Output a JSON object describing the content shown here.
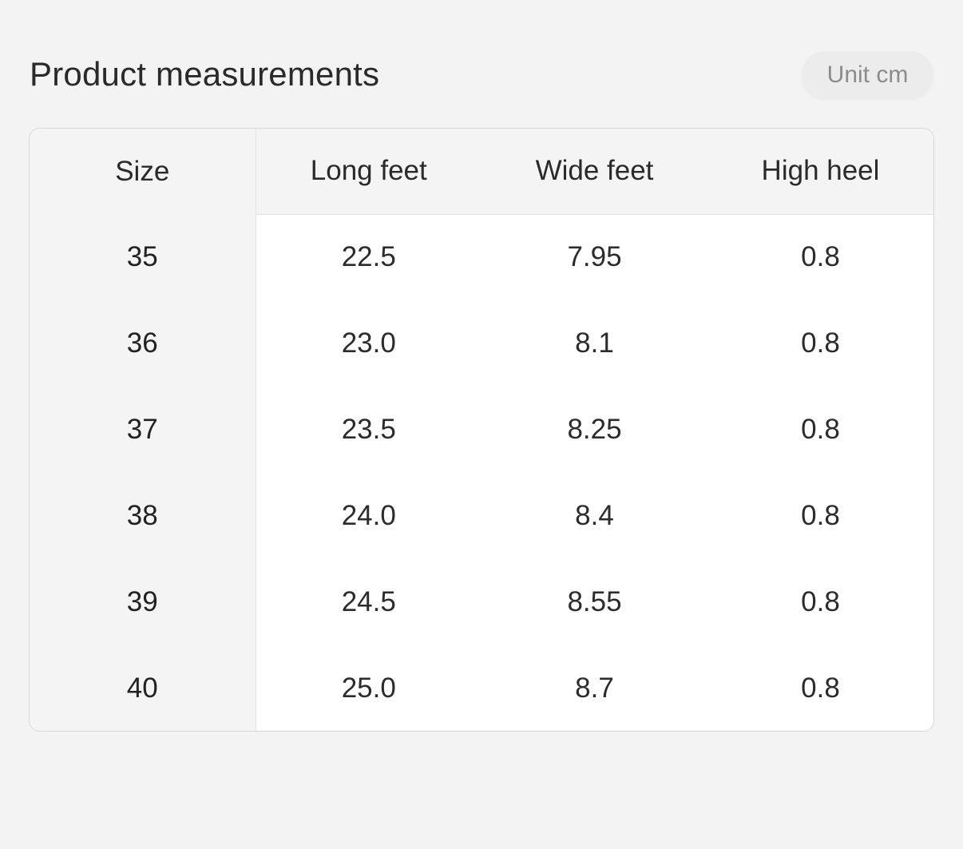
{
  "header": {
    "title": "Product measurements",
    "unit_label": "Unit cm"
  },
  "table": {
    "columns": [
      "Size",
      "Long feet",
      "Wide feet",
      "High heel"
    ],
    "rows": [
      [
        "35",
        "22.5",
        "7.95",
        "0.8"
      ],
      [
        "36",
        "23.0",
        "8.1",
        "0.8"
      ],
      [
        "37",
        "23.5",
        "8.25",
        "0.8"
      ],
      [
        "38",
        "24.0",
        "8.4",
        "0.8"
      ],
      [
        "39",
        "24.5",
        "8.55",
        "0.8"
      ],
      [
        "40",
        "25.0",
        "8.7",
        "0.8"
      ]
    ]
  },
  "colors": {
    "page_background": "#f3f3f3",
    "header_background": "#f4f4f4",
    "cell_background": "#ffffff",
    "border": "#d6d6d6",
    "badge_background": "#ececec",
    "badge_text": "#8c8c8c"
  }
}
